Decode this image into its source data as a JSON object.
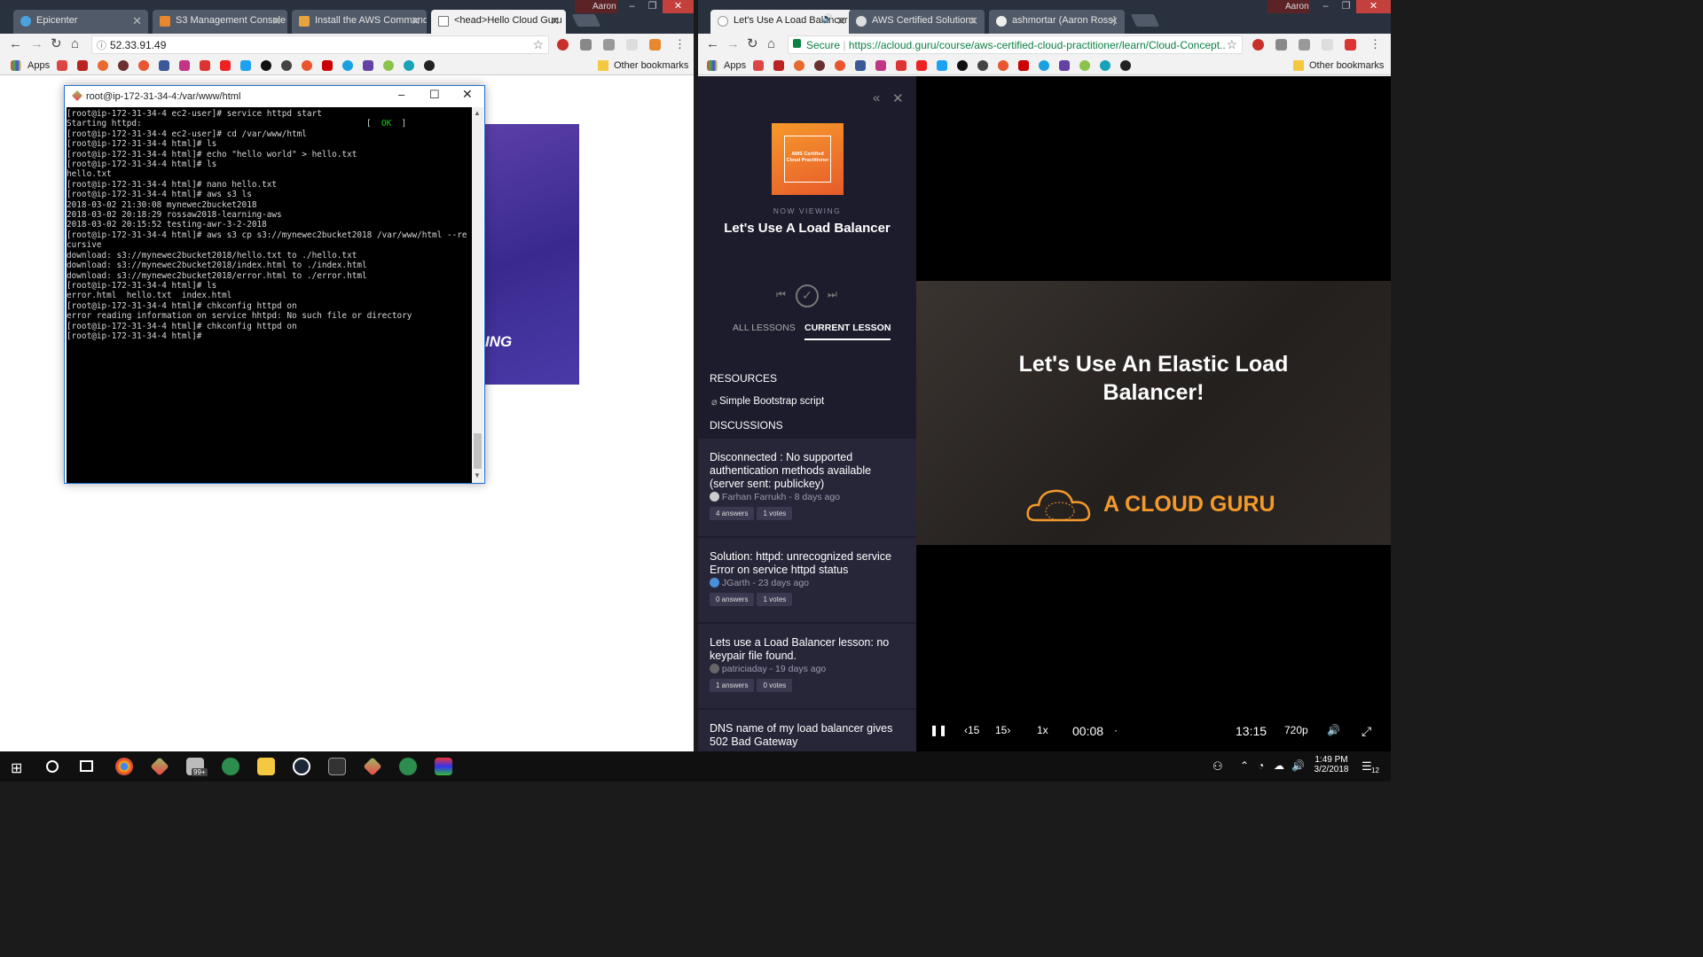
{
  "left_window": {
    "tabs": [
      {
        "label": "Epicenter",
        "icon_color": "#4aa3df"
      },
      {
        "label": "S3 Management Console",
        "icon_color": "#e8872e"
      },
      {
        "label": "Install the AWS Command",
        "icon_color": "#e8a33e"
      },
      {
        "label": "<head>Hello Cloud Guru",
        "icon_color": "#999999"
      }
    ],
    "profile": "Aaron",
    "address": "52.33.91.49",
    "bookmarks": {
      "apps": "Apps",
      "other": "Other bookmarks"
    }
  },
  "terminal": {
    "title": "root@ip-172-31-34-4:/var/www/html",
    "lines": [
      "[root@ip-172-31-34-4 ec2-user]# service httpd start",
      "Starting httpd:",
      "[root@ip-172-31-34-4 ec2-user]# cd /var/www/html",
      "[root@ip-172-31-34-4 html]# ls",
      "[root@ip-172-31-34-4 html]# echo \"hello world\" > hello.txt",
      "[root@ip-172-31-34-4 html]# ls",
      "hello.txt",
      "[root@ip-172-31-34-4 html]# nano hello.txt",
      "[root@ip-172-31-34-4 html]# aws s3 ls",
      "2018-03-02 21:30:08 mynewec2bucket2018",
      "2018-03-02 20:18:29 rossaw2018-learning-aws",
      "2018-03-02 20:15:52 testing-awr-3-2-2018",
      "[root@ip-172-31-34-4 html]# aws s3 cp s3://mynewec2bucket2018 /var/www/html --re",
      "cursive",
      "download: s3://mynewec2bucket2018/hello.txt to ./hello.txt",
      "download: s3://mynewec2bucket2018/index.html to ./index.html",
      "download: s3://mynewec2bucket2018/error.html to ./error.html",
      "[root@ip-172-31-34-4 html]# ls",
      "error.html  hello.txt  index.html",
      "[root@ip-172-31-34-4 html]# chkconfig httpd on",
      "error reading information on service hhtpd: No such file or directory",
      "[root@ip-172-31-34-4 html]# chkconfig httpd on",
      "[root@ip-172-31-34-4 html]#"
    ],
    "ok_label": "[  OK  ]",
    "bg_image_text": "ING"
  },
  "right_window": {
    "tabs": [
      {
        "label": "Let's Use A Load Balancer",
        "icon_color": "#dddddd"
      },
      {
        "label": "AWS Certified Solutions",
        "icon_color": "#dddddd"
      },
      {
        "label": "ashmortar (Aaron Ross)",
        "icon_color": "#dddddd"
      }
    ],
    "profile": "Aaron",
    "secure": "Secure",
    "address": "https://acloud.guru/course/aws-certified-cloud-practitioner/learn/Cloud-Concept...",
    "bookmarks": {
      "apps": "Apps",
      "other": "Other bookmarks"
    }
  },
  "course": {
    "badge_line1": "AWS Certified",
    "badge_line2": "Cloud Practitioner",
    "now_viewing": "NOW VIEWING",
    "lesson_title": "Let's Use A Load Balancer",
    "tab_all": "ALL LESSONS",
    "tab_current": "CURRENT LESSON",
    "resources_heading": "RESOURCES",
    "resource": "Simple Bootstrap script",
    "discussions_heading": "DISCUSSIONS",
    "discussions": [
      {
        "title": "Disconnected : No supported authentication methods available (server sent: publickey)",
        "author": "Farhan Farrukh",
        "age": "8 days ago",
        "answers": "4 answers",
        "votes": "1 votes"
      },
      {
        "title": "Solution: httpd: unrecognized service Error on service httpd status",
        "author": "JGarth",
        "age": "23 days ago",
        "answers": "0 answers",
        "votes": "1 votes"
      },
      {
        "title": "Lets use a Load Balancer lesson: no keypair file found.",
        "author": "patriciaday",
        "age": "19 days ago",
        "answers": "1 answers",
        "votes": "0 votes"
      },
      {
        "title": "DNS name of my load balancer gives 502 Bad Gateway",
        "author": "",
        "age": "",
        "answers": "",
        "votes": ""
      }
    ]
  },
  "video": {
    "title_line1": "Let's Use An Elastic Load",
    "title_line2": "Balancer!",
    "brand": "A CLOUD GURU",
    "controls": {
      "back": "15",
      "fwd": "15",
      "speed": "1x",
      "current": "00:08",
      "duration": "13:15",
      "quality": "720p"
    }
  },
  "taskbar": {
    "time": "1:49 PM",
    "date": "3/2/2018",
    "notifications": "12",
    "mail_badge": "99+"
  }
}
